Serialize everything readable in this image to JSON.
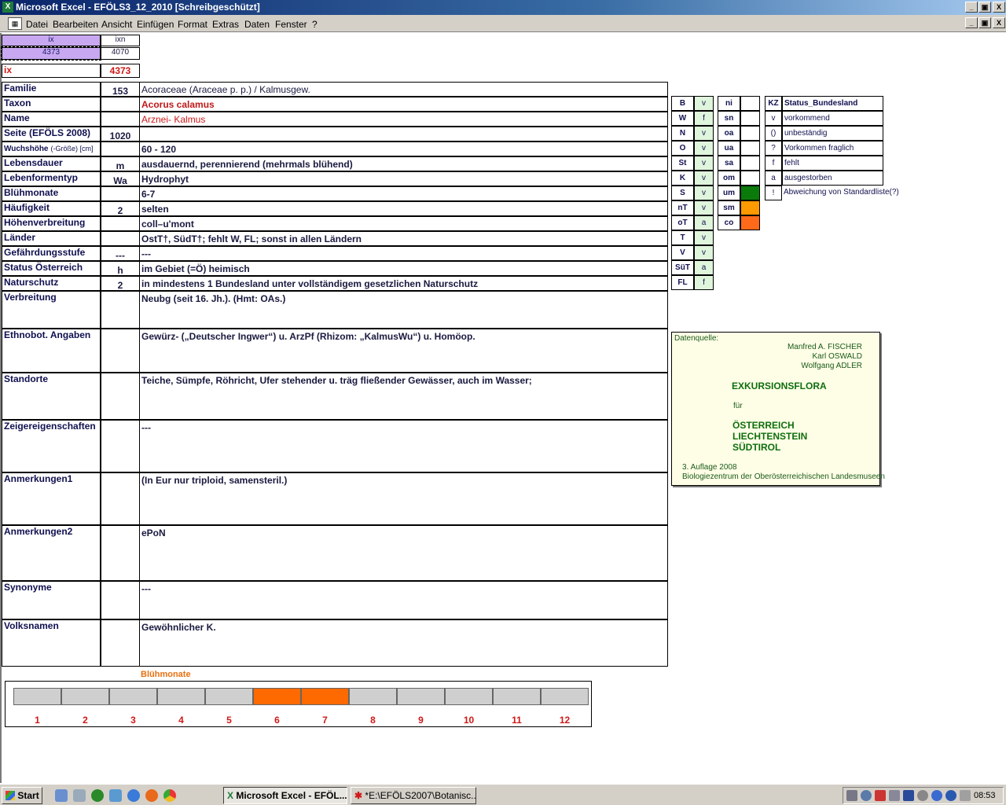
{
  "window": {
    "title": "Microsoft Excel - EFÖLS3_12_2010  [Schreibgeschützt]",
    "app_icon": "excel-icon",
    "buttons": [
      "_",
      "▣",
      "X"
    ]
  },
  "menu": [
    "Datei",
    "Bearbeiten",
    "Ansicht",
    "Einfügen",
    "Format",
    "Extras",
    "Daten",
    "Fenster",
    "?"
  ],
  "top": {
    "ix_header": "ix",
    "ixn_header": "ixn",
    "ix_value": "4373",
    "ixn_value": "4070",
    "ix_label": "ix",
    "ix_big": "4373"
  },
  "rows": [
    {
      "label": "Familie",
      "code": "153",
      "value": "Acoraceae (Araceae p. p.)  /  Kalmusgew."
    },
    {
      "label": "Taxon",
      "code": "",
      "value": "Acorus calamus"
    },
    {
      "label": "Name",
      "code": "",
      "value": "Arznei- Kalmus"
    },
    {
      "label": "Seite (EFÖLS 2008)",
      "code": "1020",
      "value": ""
    },
    {
      "label": "Wuchshöhe",
      "label_suffix": "(-Größe) [cm]",
      "code": "",
      "value": " 60 - 120"
    },
    {
      "label": "Lebensdauer",
      "code": "m",
      "value": "ausdauernd, perennierend (mehrmals blühend)"
    },
    {
      "label": "Lebenformentyp",
      "code": "Wa",
      "value": "Hydrophyt"
    },
    {
      "label": "Blühmonate",
      "code": "",
      "value": " 6-7"
    },
    {
      "label": "Häufigkeit",
      "code": "2",
      "value": "selten"
    },
    {
      "label": "Höhenverbreitung",
      "code": "",
      "value": "coll–u'mont"
    },
    {
      "label": "Länder",
      "code": "",
      "value": "OstT†, SüdT†; fehlt W, FL; sonst in allen Ländern"
    },
    {
      "label": "Gefährdungsstufe",
      "code": "---",
      "value": "  ---"
    },
    {
      "label": "Status Österreich",
      "code": "h",
      "value": "im Gebiet (=Ö) heimisch"
    },
    {
      "label": "Naturschutz",
      "code": "2",
      "value": "in mindestens 1 Bundesland unter vollständigem gesetzlichen Naturschutz"
    },
    {
      "label": "Verbreitung",
      "code": "",
      "value": "Neubg (seit 16. Jh.). (Hmt: OAs.)"
    },
    {
      "label": "Ethnobot. Angaben",
      "code": "",
      "value": "Gewürz- („Deutscher Ingwer“) u. ArzPf (Rhizom: „KalmusWu“) u. Homöop."
    },
    {
      "label": "Standorte",
      "code": "",
      "value": "Teiche, Sümpfe, Röhricht, Ufer stehender u. träg fließender Gewässer, auch im Wasser;"
    },
    {
      "label": "Zeigereigenschaften",
      "code": "",
      "value": "---"
    },
    {
      "label": "Anmerkungen1",
      "code": "",
      "value": "(In Eur nur triploid, samensteril.)"
    },
    {
      "label": "Anmerkungen2",
      "code": "",
      "value": "ePoN"
    },
    {
      "label": "Synonyme",
      "code": "",
      "value": "---"
    },
    {
      "label": "Volksnamen",
      "code": "",
      "value": "Gewöhnlicher K."
    }
  ],
  "states": [
    {
      "code": "B",
      "val": "v"
    },
    {
      "code": "W",
      "val": "f"
    },
    {
      "code": "N",
      "val": "v"
    },
    {
      "code": "O",
      "val": "v"
    },
    {
      "code": "St",
      "val": "v"
    },
    {
      "code": "K",
      "val": "v"
    },
    {
      "code": "S",
      "val": "v"
    },
    {
      "code": "nT",
      "val": "v"
    },
    {
      "code": "oT",
      "val": "a"
    },
    {
      "code": "T",
      "val": "v"
    },
    {
      "code": "V",
      "val": "v"
    },
    {
      "code": "SüT",
      "val": "a"
    },
    {
      "code": "FL",
      "val": "f"
    }
  ],
  "zones": [
    {
      "code": "ni",
      "color": ""
    },
    {
      "code": "sn",
      "color": ""
    },
    {
      "code": "oa",
      "color": ""
    },
    {
      "code": "ua",
      "color": ""
    },
    {
      "code": "sa",
      "color": ""
    },
    {
      "code": "om",
      "color": ""
    },
    {
      "code": "um",
      "color": "#0a7a0a"
    },
    {
      "code": "sm",
      "color": "#ff9900"
    },
    {
      "code": "co",
      "color": "#ff6a1a"
    }
  ],
  "legend": {
    "kz": "KZ",
    "header": "Status_Bundesland",
    "items": [
      {
        "k": "v",
        "t": "vorkommend"
      },
      {
        "k": "()",
        "t": "unbeständig"
      },
      {
        "k": "?",
        "t": "Vorkommen fraglich"
      },
      {
        "k": "f",
        "t": "fehlt"
      },
      {
        "k": "a",
        "t": "ausgestorben"
      },
      {
        "k": "!",
        "t": "Abweichung von Standardliste(?)"
      }
    ]
  },
  "source": {
    "label": "Datenquelle:",
    "authors": [
      "Manfred A. FISCHER",
      "Karl OSWALD",
      "Wolfgang ADLER"
    ],
    "title": "EXKURSIONSFLORA",
    "fuer": "für",
    "countries": [
      "ÖSTERREICH",
      "LIECHTENSTEIN",
      "SÜDTIROL"
    ],
    "edition": "3. Auflage 2008",
    "publisher": "Biologiezentrum der Oberösterreichischen Landesmuseen"
  },
  "bloom": {
    "title": "Blühmonate",
    "months": [
      "1",
      "2",
      "3",
      "4",
      "5",
      "6",
      "7",
      "8",
      "9",
      "10",
      "11",
      "12"
    ],
    "active": [
      false,
      false,
      false,
      false,
      false,
      true,
      true,
      false,
      false,
      false,
      false,
      false
    ],
    "active_color": "#ff6a00"
  },
  "taskbar": {
    "start": "Start",
    "tasks": [
      "Microsoft Excel - EFÖL...",
      "*E:\\EFÖLS2007\\Botanisc..."
    ],
    "clock": "08:53"
  }
}
